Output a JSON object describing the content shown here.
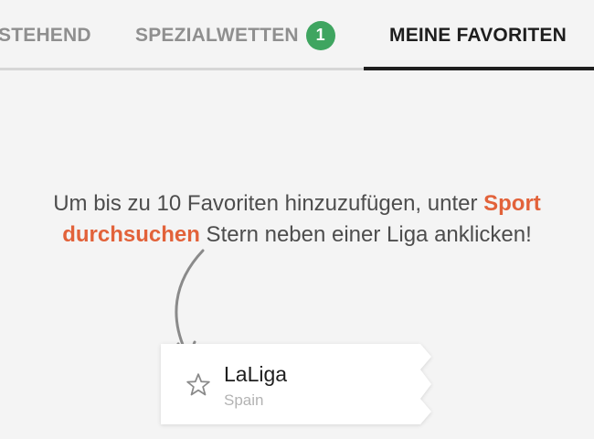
{
  "tabs": [
    {
      "label": "STEHEND",
      "active": false
    },
    {
      "label": "SPEZIALWETTEN",
      "active": false,
      "badge": "1"
    },
    {
      "label": "MEINE FAVORITEN",
      "active": true
    }
  ],
  "empty_state": {
    "text_before": "Um bis zu 10 Favoriten hinzuzufügen, unter ",
    "link": "Sport durchsuchen",
    "text_after": " Stern neben einer Liga anklicken!"
  },
  "example_card": {
    "title": "LaLiga",
    "subtitle": "Spain",
    "icon": "star-outline-icon"
  },
  "colors": {
    "accent": "#e2623a",
    "badge": "#3fa560",
    "active_tab": "#1e1e1e",
    "inactive_tab": "#8f8f8f",
    "background": "#f4f4f4"
  }
}
